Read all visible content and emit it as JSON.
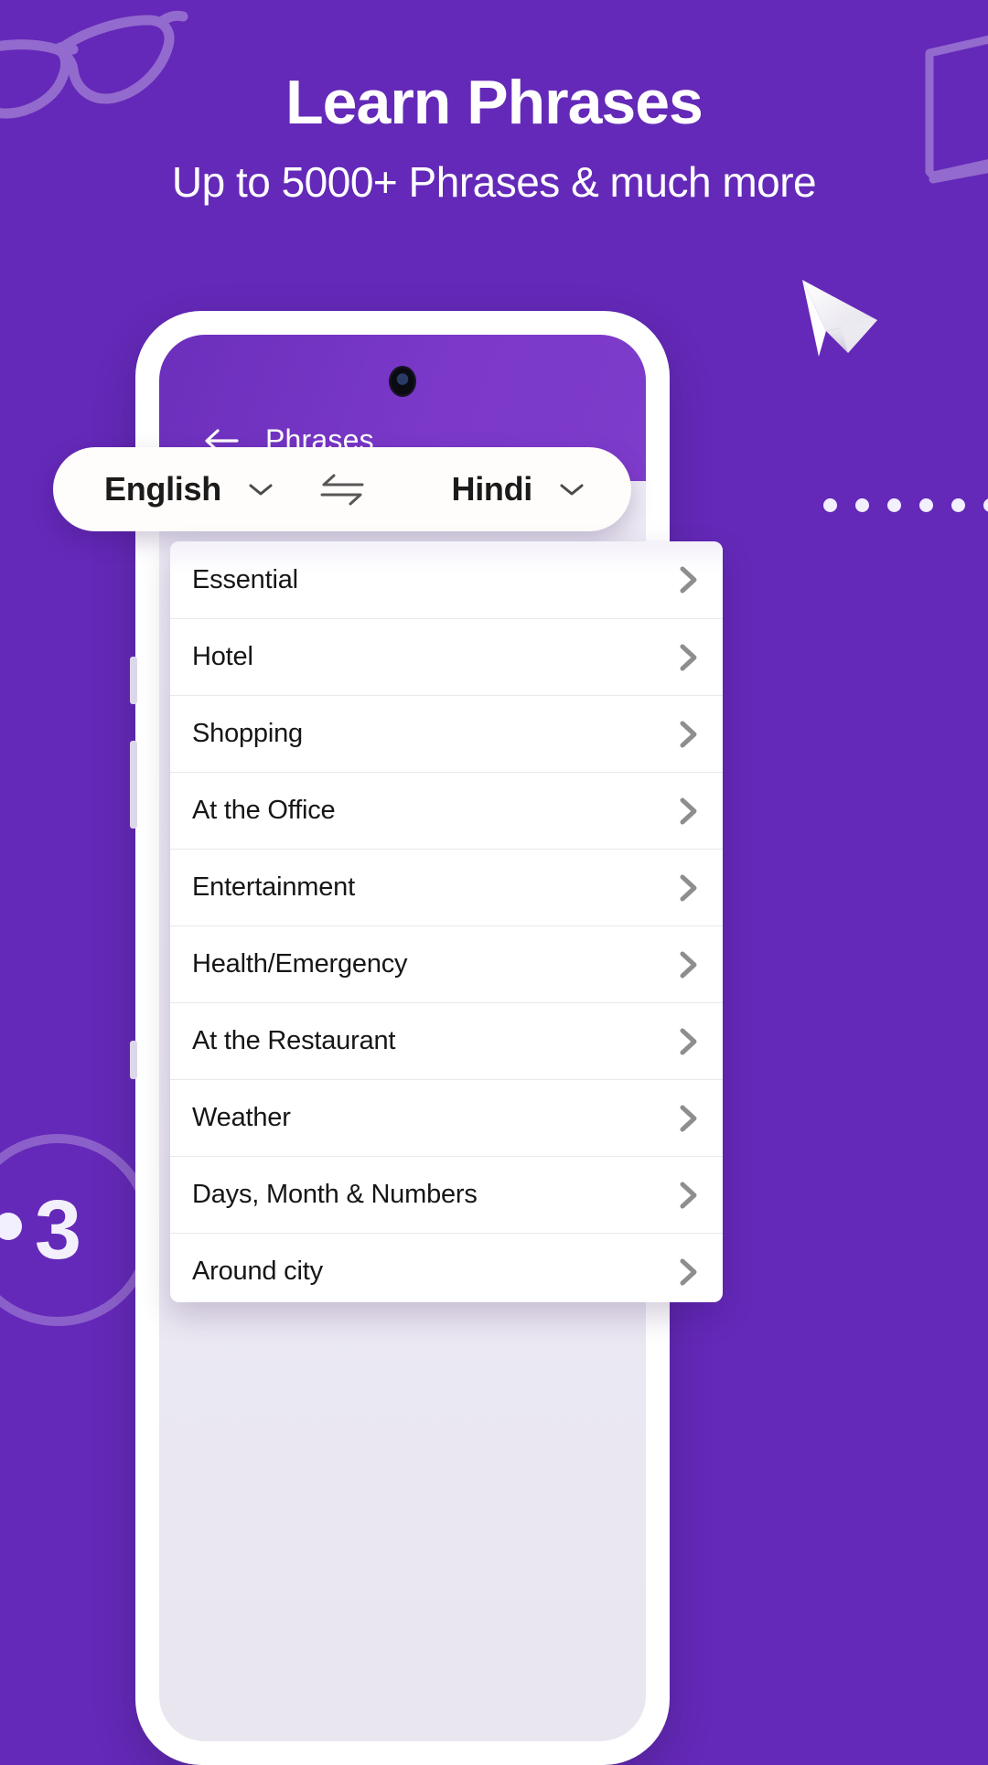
{
  "promo": {
    "title": "Learn Phrases",
    "subtitle": "Up to 5000+ Phrases & much more",
    "step_number": "3",
    "background_color": "#6429b8",
    "accent_color": "#7b38c9"
  },
  "decorations": {
    "glasses_icon": "glasses-icon",
    "book_icon": "book-icon",
    "paper_plane_icon": "paper-plane-icon",
    "dots_count": 6
  },
  "app": {
    "appbar": {
      "back_icon": "arrow-left-icon",
      "title": "Phrases"
    },
    "language_selector": {
      "source_language": "English",
      "target_language": "Hindi",
      "source_caret_icon": "chevron-down-icon",
      "target_caret_icon": "chevron-down-icon",
      "swap_icon": "swap-horizontal-icon"
    },
    "categories": [
      {
        "label": "Essential",
        "chevron_icon": "chevron-right-icon"
      },
      {
        "label": "Hotel",
        "chevron_icon": "chevron-right-icon"
      },
      {
        "label": "Shopping",
        "chevron_icon": "chevron-right-icon"
      },
      {
        "label": "At the Office",
        "chevron_icon": "chevron-right-icon"
      },
      {
        "label": "Entertainment",
        "chevron_icon": "chevron-right-icon"
      },
      {
        "label": "Health/Emergency",
        "chevron_icon": "chevron-right-icon"
      },
      {
        "label": "At the Restaurant",
        "chevron_icon": "chevron-right-icon"
      },
      {
        "label": "Weather",
        "chevron_icon": "chevron-right-icon"
      },
      {
        "label": "Days, Month & Numbers",
        "chevron_icon": "chevron-right-icon"
      },
      {
        "label": "Around city",
        "chevron_icon": "chevron-right-icon"
      }
    ]
  }
}
